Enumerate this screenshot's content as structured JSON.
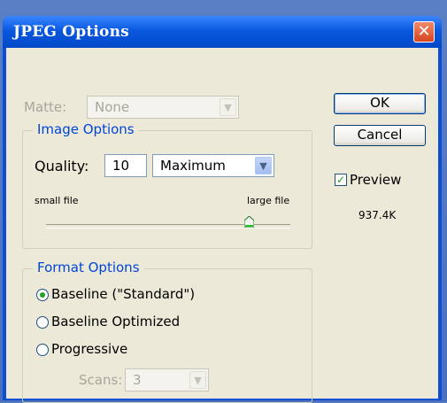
{
  "window": {
    "title": "JPEG Options",
    "close_glyph": "✕"
  },
  "matte": {
    "label": "Matte:",
    "value": "None"
  },
  "buttons": {
    "ok": "OK",
    "cancel": "Cancel"
  },
  "preview": {
    "label": "Preview",
    "checked": true,
    "file_size": "937.4K"
  },
  "image_options": {
    "legend": "Image Options",
    "quality_label": "Quality:",
    "quality_value": "10",
    "quality_preset": "Maximum",
    "slider_min_label": "small file",
    "slider_max_label": "large file",
    "slider_value_fraction": 0.83
  },
  "format_options": {
    "legend": "Format Options",
    "options": [
      {
        "label": "Baseline (\"Standard\")",
        "selected": true
      },
      {
        "label": "Baseline Optimized",
        "selected": false
      },
      {
        "label": "Progressive",
        "selected": false
      }
    ],
    "scans_label": "Scans:",
    "scans_value": "3"
  },
  "icons": {
    "dropdown": "chevron-down-icon",
    "close": "close-icon",
    "check": "checkmark-icon",
    "slider": "slider-thumb-icon"
  }
}
